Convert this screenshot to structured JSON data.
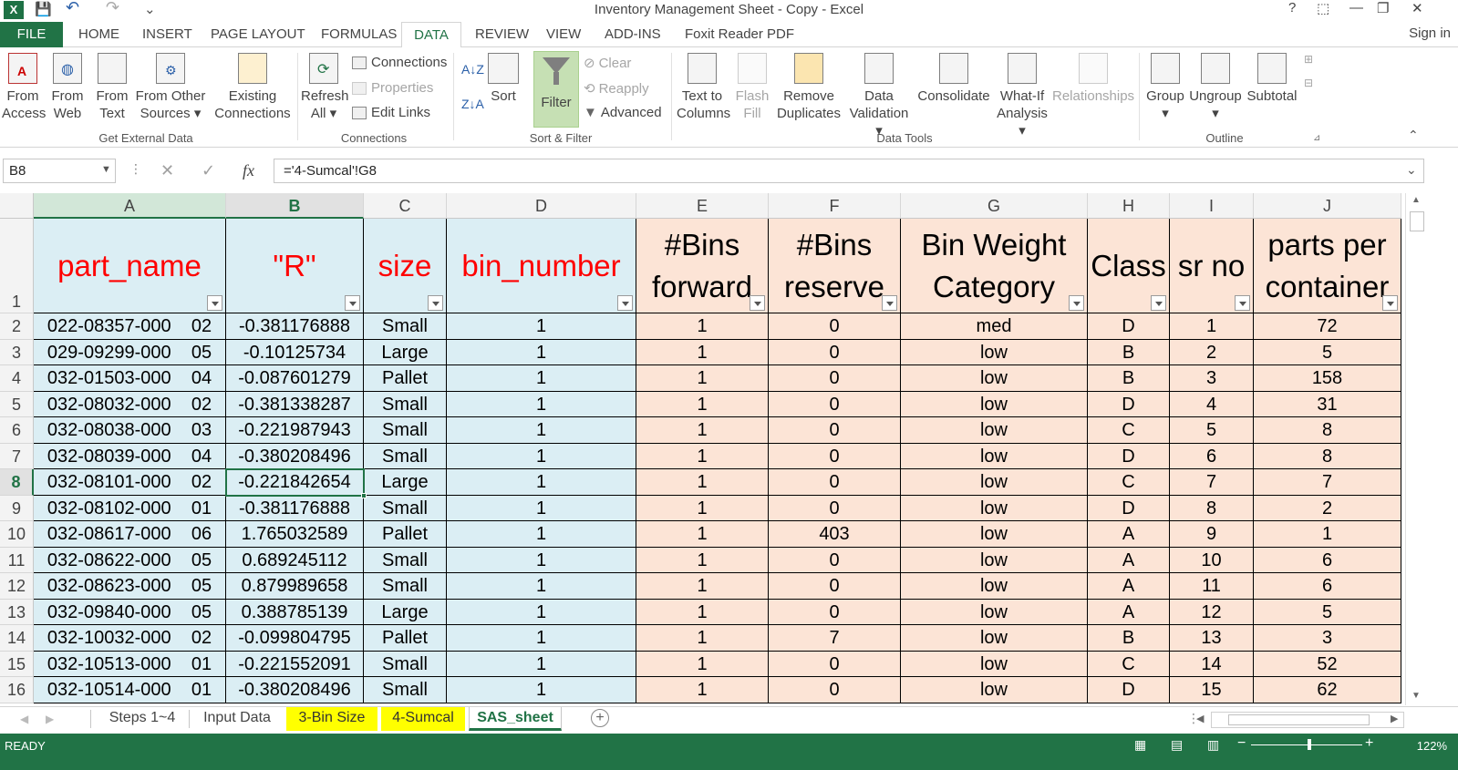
{
  "window": {
    "title": "Inventory Management Sheet - Copy - Excel",
    "help": "?",
    "minimize": "—",
    "restore": "❐",
    "close": "✕",
    "sign_in": "Sign in"
  },
  "quick_access": {
    "save": "💾",
    "undo": "↶",
    "redo": "↷",
    "customize": "⌄"
  },
  "tabs": [
    "FILE",
    "HOME",
    "INSERT",
    "PAGE LAYOUT",
    "FORMULAS",
    "DATA",
    "REVIEW",
    "VIEW",
    "ADD-INS",
    "Foxit Reader PDF"
  ],
  "active_tab": "DATA",
  "ribbon": {
    "get_external": {
      "label": "Get External Data",
      "from_access": [
        "From",
        "Access"
      ],
      "from_web": [
        "From",
        "Web"
      ],
      "from_text": [
        "From",
        "Text"
      ],
      "from_other": [
        "From Other",
        "Sources ▾"
      ],
      "existing": [
        "Existing",
        "Connections"
      ]
    },
    "connections": {
      "label": "Connections",
      "refresh": [
        "Refresh",
        "All ▾"
      ],
      "connections": "Connections",
      "properties": "Properties",
      "edit_links": "Edit Links"
    },
    "sort_filter": {
      "label": "Sort & Filter",
      "sort": "Sort",
      "filter": "Filter",
      "clear": "Clear",
      "reapply": "Reapply",
      "advanced": "Advanced"
    },
    "data_tools": {
      "label": "Data Tools",
      "text_to_columns": [
        "Text to",
        "Columns"
      ],
      "flash_fill": [
        "Flash",
        "Fill"
      ],
      "remove_duplicates": [
        "Remove",
        "Duplicates"
      ],
      "data_validation": [
        "Data",
        "Validation ▾"
      ],
      "consolidate": "Consolidate",
      "what_if": [
        "What-If",
        "Analysis ▾"
      ],
      "relationships": "Relationships"
    },
    "outline": {
      "label": "Outline",
      "group": "Group",
      "ungroup": "Ungroup",
      "subtotal": "Subtotal"
    }
  },
  "formula_bar": {
    "name_box": "B8",
    "fx": "fx",
    "formula": "='4-Sumcal'!G8"
  },
  "columns": [
    "A",
    "B",
    "C",
    "D",
    "E",
    "F",
    "G",
    "H",
    "I",
    "J"
  ],
  "header_row": {
    "A": [
      "part_name"
    ],
    "B": [
      "\"R\""
    ],
    "C": [
      "size"
    ],
    "D": [
      "bin_number"
    ],
    "E": [
      "#Bins",
      "forward"
    ],
    "F": [
      "#Bins",
      "reserve"
    ],
    "G": [
      "Bin Weight",
      "Category"
    ],
    "H": [
      "Class"
    ],
    "I": [
      "sr no"
    ],
    "J": [
      "parts per",
      "container"
    ]
  },
  "rows": [
    {
      "n": "2",
      "c": [
        "022-08357-000    02",
        "-0.381176888",
        "Small",
        "1",
        "1",
        "0",
        "med",
        "D",
        "1",
        "72"
      ]
    },
    {
      "n": "3",
      "c": [
        "029-09299-000    05",
        "-0.10125734",
        "Large",
        "1",
        "1",
        "0",
        "low",
        "B",
        "2",
        "5"
      ]
    },
    {
      "n": "4",
      "c": [
        "032-01503-000    04",
        "-0.087601279",
        "Pallet",
        "1",
        "1",
        "0",
        "low",
        "B",
        "3",
        "158"
      ]
    },
    {
      "n": "5",
      "c": [
        "032-08032-000    02",
        "-0.381338287",
        "Small",
        "1",
        "1",
        "0",
        "low",
        "D",
        "4",
        "31"
      ]
    },
    {
      "n": "6",
      "c": [
        "032-08038-000    03",
        "-0.221987943",
        "Small",
        "1",
        "1",
        "0",
        "low",
        "C",
        "5",
        "8"
      ]
    },
    {
      "n": "7",
      "c": [
        "032-08039-000    04",
        "-0.380208496",
        "Small",
        "1",
        "1",
        "0",
        "low",
        "D",
        "6",
        "8"
      ]
    },
    {
      "n": "8",
      "c": [
        "032-08101-000    02",
        "-0.221842654",
        "Large",
        "1",
        "1",
        "0",
        "low",
        "C",
        "7",
        "7"
      ]
    },
    {
      "n": "9",
      "c": [
        "032-08102-000    01",
        "-0.381176888",
        "Small",
        "1",
        "1",
        "0",
        "low",
        "D",
        "8",
        "2"
      ]
    },
    {
      "n": "10",
      "c": [
        "032-08617-000    06",
        "1.765032589",
        "Pallet",
        "1",
        "1",
        "403",
        "low",
        "A",
        "9",
        "1"
      ]
    },
    {
      "n": "11",
      "c": [
        "032-08622-000    05",
        "0.689245112",
        "Small",
        "1",
        "1",
        "0",
        "low",
        "A",
        "10",
        "6"
      ]
    },
    {
      "n": "12",
      "c": [
        "032-08623-000    05",
        "0.879989658",
        "Small",
        "1",
        "1",
        "0",
        "low",
        "A",
        "11",
        "6"
      ]
    },
    {
      "n": "13",
      "c": [
        "032-09840-000    05",
        "0.388785139",
        "Large",
        "1",
        "1",
        "0",
        "low",
        "A",
        "12",
        "5"
      ]
    },
    {
      "n": "14",
      "c": [
        "032-10032-000    02",
        "-0.099804795",
        "Pallet",
        "1",
        "1",
        "7",
        "low",
        "B",
        "13",
        "3"
      ]
    },
    {
      "n": "15",
      "c": [
        "032-10513-000    01",
        "-0.221552091",
        "Small",
        "1",
        "1",
        "0",
        "low",
        "C",
        "14",
        "52"
      ]
    },
    {
      "n": "16",
      "c": [
        "032-10514-000    01",
        "-0.380208496",
        "Small",
        "1",
        "1",
        "0",
        "low",
        "D",
        "15",
        "62"
      ]
    }
  ],
  "sheet_tabs": [
    {
      "label": "Steps 1~4",
      "style": "normal"
    },
    {
      "label": "Input Data",
      "style": "normal"
    },
    {
      "label": "3-Bin Size",
      "style": "yellow"
    },
    {
      "label": "4-Sumcal",
      "style": "yellow"
    },
    {
      "label": "SAS_sheet",
      "style": "active"
    }
  ],
  "status": {
    "ready": "READY",
    "zoom": "122%"
  },
  "colors": {
    "excel_green": "#217346",
    "blue_fill": "#dbeef4",
    "peach_fill": "#fce4d6",
    "header_red": "#ff0000",
    "tab_yellow": "#ffff00"
  }
}
